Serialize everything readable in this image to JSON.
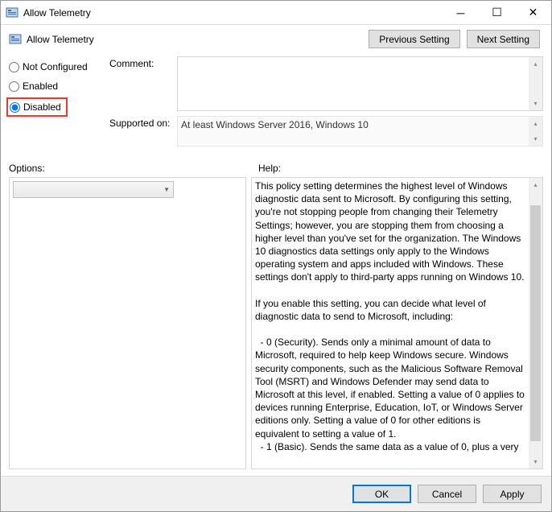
{
  "window": {
    "title": "Allow Telemetry"
  },
  "header": {
    "title": "Allow Telemetry",
    "previous": "Previous Setting",
    "next": "Next Setting"
  },
  "radios": {
    "not_configured": "Not Configured",
    "enabled": "Enabled",
    "disabled": "Disabled",
    "selected": "disabled"
  },
  "fields": {
    "comment_label": "Comment:",
    "comment_value": "",
    "supported_label": "Supported on:",
    "supported_value": "At least Windows Server 2016, Windows 10"
  },
  "sections": {
    "options": "Options:",
    "help": "Help:"
  },
  "help_text": "This policy setting determines the highest level of Windows diagnostic data sent to Microsoft. By configuring this setting, you're not stopping people from changing their Telemetry Settings; however, you are stopping them from choosing a higher level than you've set for the organization. The Windows 10 diagnostics data settings only apply to the Windows operating system and apps included with Windows. These settings don't apply to third-party apps running on Windows 10.\n\nIf you enable this setting, you can decide what level of diagnostic data to send to Microsoft, including:\n\n  - 0 (Security). Sends only a minimal amount of data to Microsoft, required to help keep Windows secure. Windows security components, such as the Malicious Software Removal Tool (MSRT) and Windows Defender may send data to Microsoft at this level, if enabled. Setting a value of 0 applies to devices running Enterprise, Education, IoT, or Windows Server editions only. Setting a value of 0 for other editions is equivalent to setting a value of 1.\n  - 1 (Basic). Sends the same data as a value of 0, plus a very",
  "footer": {
    "ok": "OK",
    "cancel": "Cancel",
    "apply": "Apply"
  }
}
